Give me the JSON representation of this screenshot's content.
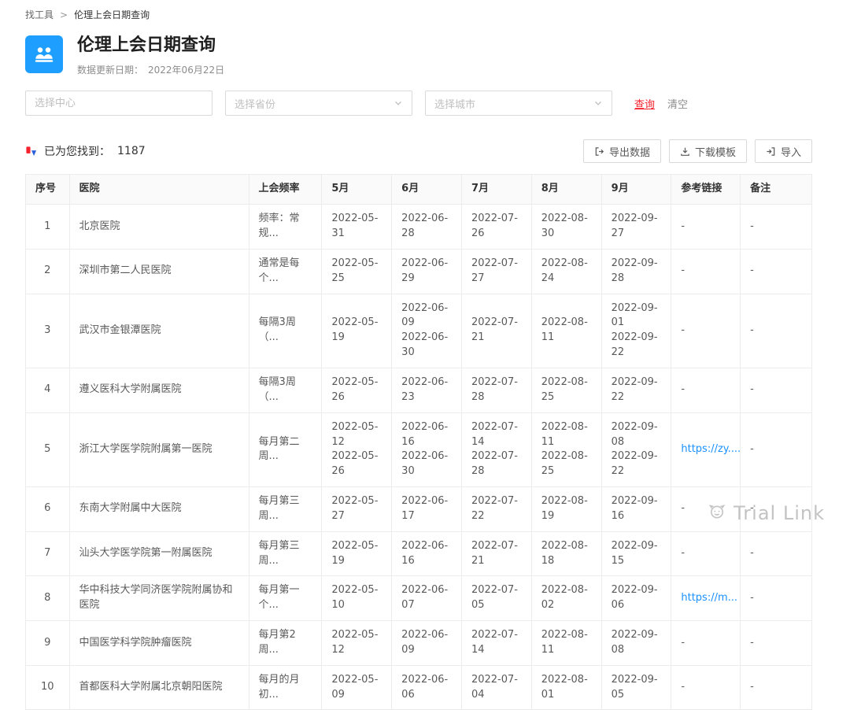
{
  "breadcrumb": {
    "root": "找工具",
    "separator": ">",
    "current": "伦理上会日期查询"
  },
  "header": {
    "title": "伦理上会日期查询",
    "update_label": "数据更新日期：",
    "update_date": "2022年06月22日"
  },
  "filters": {
    "center_placeholder": "选择中心",
    "province_placeholder": "选择省份",
    "city_placeholder": "选择城市",
    "search_label": "查询",
    "clear_label": "清空"
  },
  "results": {
    "found_label": "已为您找到：",
    "count": "1187",
    "export_label": "导出数据",
    "template_label": "下载模板",
    "import_label": "导入"
  },
  "table": {
    "headers": [
      "序号",
      "医院",
      "上会频率",
      "5月",
      "6月",
      "7月",
      "8月",
      "9月",
      "参考链接",
      "备注"
    ],
    "rows": [
      [
        "1",
        "北京医院",
        "频率：常规...",
        "2022-05-31",
        "2022-06-28",
        "2022-07-26",
        "2022-08-30",
        "2022-09-27",
        "-",
        "-"
      ],
      [
        "2",
        "深圳市第二人民医院",
        "通常是每个...",
        "2022-05-25",
        "2022-06-29",
        "2022-07-27",
        "2022-08-24",
        "2022-09-28",
        "-",
        "-"
      ],
      [
        "3",
        "武汉市金银潭医院",
        "每隔3周（...",
        "2022-05-19",
        "2022-06-09\n2022-06-30",
        "2022-07-21",
        "2022-08-11",
        "2022-09-01\n2022-09-22",
        "-",
        "-"
      ],
      [
        "4",
        "遵义医科大学附属医院",
        "每隔3周（...",
        "2022-05-26",
        "2022-06-23",
        "2022-07-28",
        "2022-08-25",
        "2022-09-22",
        "-",
        "-"
      ],
      [
        "5",
        "浙江大学医学院附属第一医院",
        "每月第二周...",
        "2022-05-12\n2022-05-26",
        "2022-06-16\n2022-06-30",
        "2022-07-14\n2022-07-28",
        "2022-08-11\n2022-08-25",
        "2022-09-08\n2022-09-22",
        "https://zy....",
        "-"
      ],
      [
        "6",
        "东南大学附属中大医院",
        "每月第三周...",
        "2022-05-27",
        "2022-06-17",
        "2022-07-22",
        "2022-08-19",
        "2022-09-16",
        "-",
        "-"
      ],
      [
        "7",
        "汕头大学医学院第一附属医院",
        "每月第三周...",
        "2022-05-19",
        "2022-06-16",
        "2022-07-21",
        "2022-08-18",
        "2022-09-15",
        "-",
        "-"
      ],
      [
        "8",
        "华中科技大学同济医学院附属协和医院",
        "每月第一个...",
        "2022-05-10",
        "2022-06-07",
        "2022-07-05",
        "2022-08-02",
        "2022-09-06",
        "https://m...",
        "-"
      ],
      [
        "9",
        "中国医学科学院肿瘤医院",
        "每月第2周...",
        "2022-05-12",
        "2022-06-09",
        "2022-07-14",
        "2022-08-11",
        "2022-09-08",
        "-",
        "-"
      ],
      [
        "10",
        "首都医科大学附属北京朝阳医院",
        "每月的月初...",
        "2022-05-09",
        "2022-06-06",
        "2022-07-04",
        "2022-08-01",
        "2022-09-05",
        "-",
        "-"
      ]
    ]
  },
  "watermark": {
    "text": "Trial Link"
  },
  "colors": {
    "accent_blue": "#1e9fff",
    "search_red": "#f5222d",
    "link_blue": "#1890ff"
  }
}
